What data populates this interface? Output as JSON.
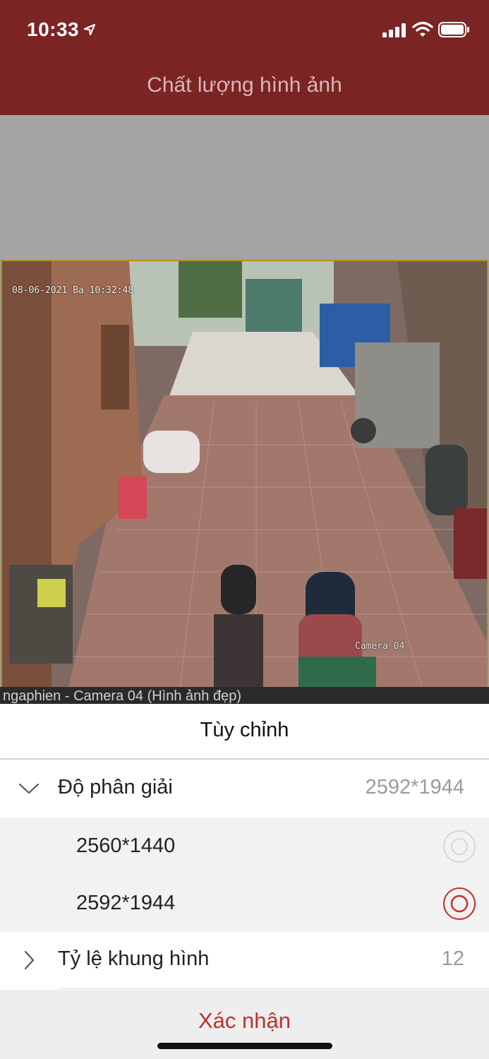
{
  "status_bar": {
    "time": "10:33",
    "icons": [
      "location-arrow-icon",
      "cellular-signal-icon",
      "wifi-icon",
      "battery-icon"
    ]
  },
  "header": {
    "title": "Chất lượng hình ảnh",
    "background": "#7b2424"
  },
  "video": {
    "timestamp": "08-06-2021 Ba  10:32:48",
    "corner_label": "Camera 04",
    "caption": "ngaphien - Camera 04 (Hình ảnh đẹp)"
  },
  "sheet": {
    "title": "Tùy chỉnh",
    "resolution": {
      "label": "Độ phân giải",
      "value": "2592*1944",
      "expanded": true,
      "options": [
        {
          "label": "2560*1440",
          "selected": false
        },
        {
          "label": "2592*1944",
          "selected": true
        }
      ]
    },
    "frame_rate": {
      "label": "Tỷ lệ khung hình",
      "value": "12",
      "expanded": false
    },
    "confirm_label": "Xác nhận",
    "accent": "#c0312b"
  }
}
